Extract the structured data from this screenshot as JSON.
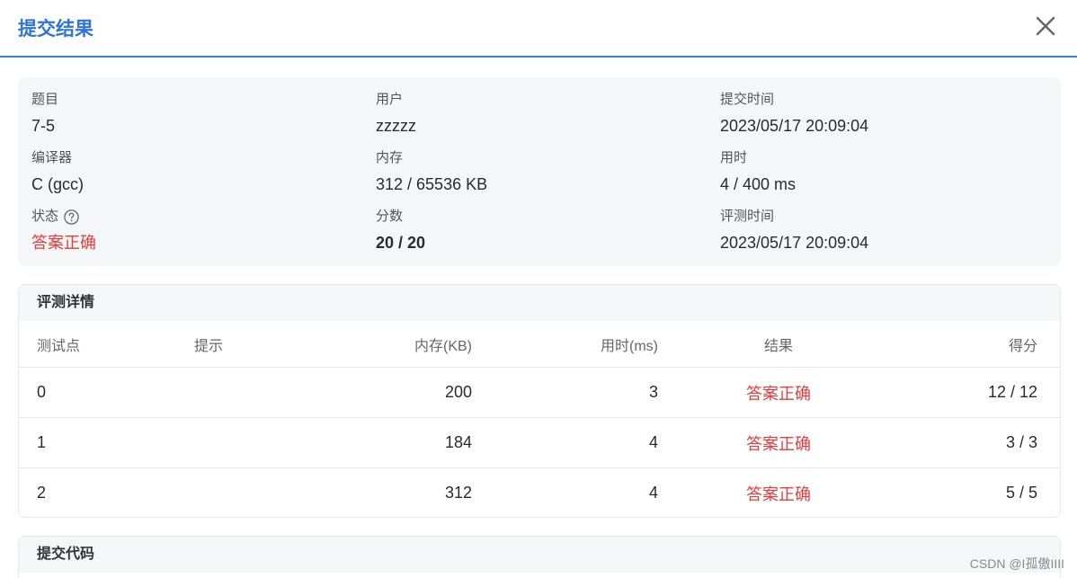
{
  "header": {
    "title": "提交结果",
    "close_icon": "close-icon"
  },
  "info": {
    "problem_label": "题目",
    "problem_value": "7-5",
    "user_label": "用户",
    "user_value": "zzzzz",
    "submit_time_label": "提交时间",
    "submit_time_value": "2023/05/17 20:09:04",
    "compiler_label": "编译器",
    "compiler_value": "C (gcc)",
    "memory_label": "内存",
    "memory_value": "312 / 65536 KB",
    "time_label": "用时",
    "time_value": "4 / 400 ms",
    "status_label": "状态",
    "status_help_icon": "question-circle-icon",
    "status_value": "答案正确",
    "score_label": "分数",
    "score_value": "20 / 20",
    "judge_time_label": "评测时间",
    "judge_time_value": "2023/05/17 20:09:04"
  },
  "judge_details": {
    "title": "评测详情",
    "columns": {
      "point": "测试点",
      "hint": "提示",
      "memory": "内存(KB)",
      "time": "用时(ms)",
      "result": "结果",
      "score": "得分"
    },
    "rows": [
      {
        "point": "0",
        "hint": "",
        "memory": "200",
        "time": "3",
        "result": "答案正确",
        "score": "12 / 12"
      },
      {
        "point": "1",
        "hint": "",
        "memory": "184",
        "time": "4",
        "result": "答案正确",
        "score": "3 / 3"
      },
      {
        "point": "2",
        "hint": "",
        "memory": "312",
        "time": "4",
        "result": "答案正确",
        "score": "5 / 5"
      }
    ]
  },
  "code_section": {
    "title": "提交代码"
  },
  "watermark": "CSDN @I孤傲IIII",
  "colors": {
    "accent": "#2f74d6",
    "accepted": "#e43c3c",
    "panel_bg": "#f5f6f8"
  }
}
